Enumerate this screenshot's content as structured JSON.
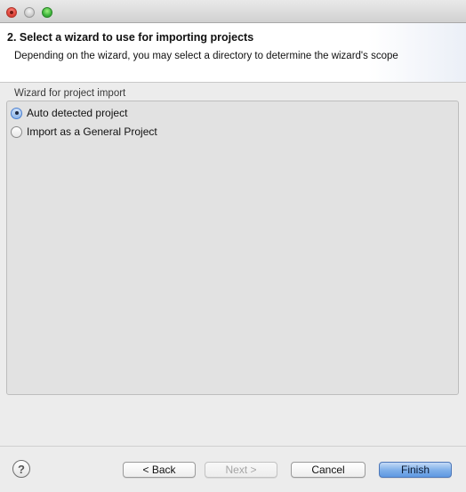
{
  "window": {
    "title": ""
  },
  "header": {
    "title": "2. Select a wizard to use for importing projects",
    "description": "Depending on the wizard, you may select a directory to determine the wizard's scope"
  },
  "group": {
    "label": "Wizard for project import",
    "options": [
      {
        "label": "Auto detected project",
        "selected": true
      },
      {
        "label": "Import as a General Project",
        "selected": false
      }
    ]
  },
  "footer": {
    "help_icon": "help-icon",
    "help_glyph": "?",
    "back_label": "< Back",
    "next_label": "Next >",
    "cancel_label": "Cancel",
    "finish_label": "Finish",
    "next_enabled": false
  },
  "colors": {
    "accent": "#5f98e2",
    "background": "#ececec",
    "group_background": "#e2e2e2"
  }
}
